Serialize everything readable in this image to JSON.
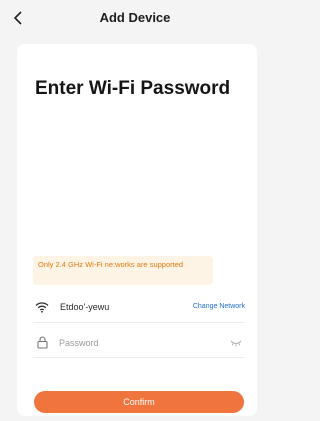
{
  "header": {
    "title": "Add Device",
    "back_icon": "chevron-left-icon"
  },
  "main": {
    "heading": "Enter Wi-Fi Password",
    "warning": "Only 2.4 GHz Wi-Fi ne:works are supported",
    "network": {
      "icon": "wifi-icon",
      "name": "Etdoo'-yewu",
      "change_label": "Change Network"
    },
    "password": {
      "icon": "lock-icon",
      "placeholder": "Password",
      "value": "",
      "visibility_icon": "eye-closed-icon"
    },
    "confirm_label": "Confirm"
  },
  "colors": {
    "background": "#f4f4f4",
    "card": "#ffffff",
    "accent": "#f0743d",
    "warning_text": "#e8770b",
    "warning_bg": "#fdf4e6",
    "link": "#1f6fd1"
  }
}
